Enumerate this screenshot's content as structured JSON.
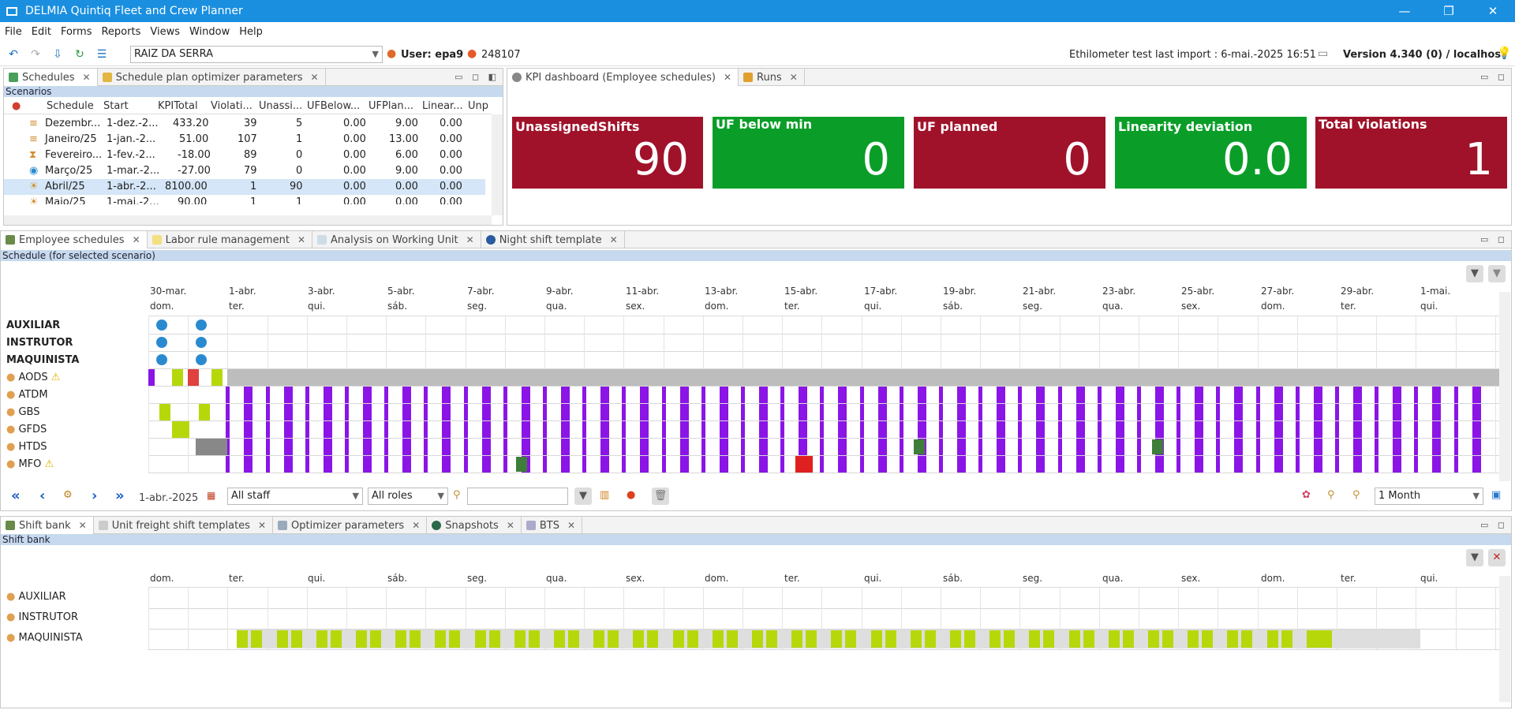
{
  "window": {
    "title": "DELMIA Quintiq Fleet and Crew Planner"
  },
  "menu": [
    "File",
    "Edit",
    "Forms",
    "Reports",
    "Views",
    "Window",
    "Help"
  ],
  "toolbar": {
    "location": "RAIZ DA SERRA",
    "user_label": "User: epa9",
    "user_id": "248107",
    "ethilometer": "Ethilometer test last import : 6-mai.-2025 16:51",
    "version": "Version 4.340 (0) / localhost"
  },
  "top_left": {
    "tabs": [
      "Schedules",
      "Schedule plan optimizer parameters"
    ],
    "section": "Scenarios",
    "columns": [
      "Schedule",
      "Start",
      "KPITotal",
      "Violati...",
      "Unassi...",
      "UFBelow...",
      "UFPlan...",
      "Linear...",
      "Unp"
    ],
    "rows": [
      [
        "Dezembr...",
        "1-dez.-2...",
        "433.20",
        "39",
        "5",
        "0.00",
        "9.00",
        "0.00"
      ],
      [
        "Janeiro/25",
        "1-jan.-2...",
        "51.00",
        "107",
        "1",
        "0.00",
        "13.00",
        "0.00"
      ],
      [
        "Fevereiro...",
        "1-fev.-2...",
        "-18.00",
        "89",
        "0",
        "0.00",
        "6.00",
        "0.00"
      ],
      [
        "Março/25",
        "1-mar.-2...",
        "-27.00",
        "79",
        "0",
        "0.00",
        "9.00",
        "0.00"
      ],
      [
        "Abril/25",
        "1-abr.-2...",
        "8100.00",
        "1",
        "90",
        "0.00",
        "0.00",
        "0.00"
      ],
      [
        "Maio/25",
        "1-mai.-2...",
        "90.00",
        "1",
        "1",
        "0.00",
        "0.00",
        "0.00"
      ]
    ]
  },
  "top_right": {
    "tabs": [
      "KPI dashboard (Employee schedules)",
      "Runs"
    ],
    "kpis": [
      {
        "label": "UnassignedShifts",
        "value": "90",
        "color": "#a0122a"
      },
      {
        "label": "UF below min",
        "value": "0",
        "color": "#0a9e28"
      },
      {
        "label": "UF planned",
        "value": "0",
        "color": "#a0122a"
      },
      {
        "label": "Linearity deviation",
        "value": "0.0",
        "color": "#0a9e28"
      },
      {
        "label": "Total violations",
        "value": "1",
        "color": "#a0122a"
      }
    ]
  },
  "middle": {
    "tabs": [
      "Employee schedules",
      "Labor rule management",
      "Analysis on Working Unit",
      "Night shift template"
    ],
    "section": "Schedule (for selected scenario)",
    "dates": [
      [
        "30-mar.",
        "dom."
      ],
      [
        "1-abr.",
        "ter."
      ],
      [
        "3-abr.",
        "qui."
      ],
      [
        "5-abr.",
        "sáb."
      ],
      [
        "7-abr.",
        "seg."
      ],
      [
        "9-abr.",
        "qua."
      ],
      [
        "11-abr.",
        "sex."
      ],
      [
        "13-abr.",
        "dom."
      ],
      [
        "15-abr.",
        "ter."
      ],
      [
        "17-abr.",
        "qui."
      ],
      [
        "19-abr.",
        "sáb."
      ],
      [
        "21-abr.",
        "seg."
      ],
      [
        "23-abr.",
        "qua."
      ],
      [
        "25-abr.",
        "sex."
      ],
      [
        "27-abr.",
        "dom."
      ],
      [
        "29-abr.",
        "ter."
      ],
      [
        "1-mai.",
        "qui."
      ]
    ],
    "groups": [
      "AUXILIAR",
      "INSTRUTOR",
      "MAQUINISTA"
    ],
    "employees": [
      "AODS",
      "ATDM",
      "GBS",
      "GFDS",
      "HTDS",
      "MFO"
    ],
    "current_date": "1-abr.-2025",
    "staff_filter": "All staff",
    "role_filter": "All roles",
    "period": "1 Month"
  },
  "bottom": {
    "tabs": [
      "Shift bank",
      "Unit freight shift templates",
      "Optimizer parameters",
      "Snapshots",
      "BTS"
    ],
    "section": "Shift bank",
    "days": [
      "dom.",
      "ter.",
      "qui.",
      "sáb.",
      "seg.",
      "qua.",
      "sex.",
      "dom.",
      "ter.",
      "qui.",
      "sáb.",
      "seg.",
      "qua.",
      "sex.",
      "dom.",
      "ter.",
      "qui."
    ],
    "rows": [
      "AUXILIAR",
      "INSTRUTOR",
      "MAQUINISTA"
    ]
  }
}
